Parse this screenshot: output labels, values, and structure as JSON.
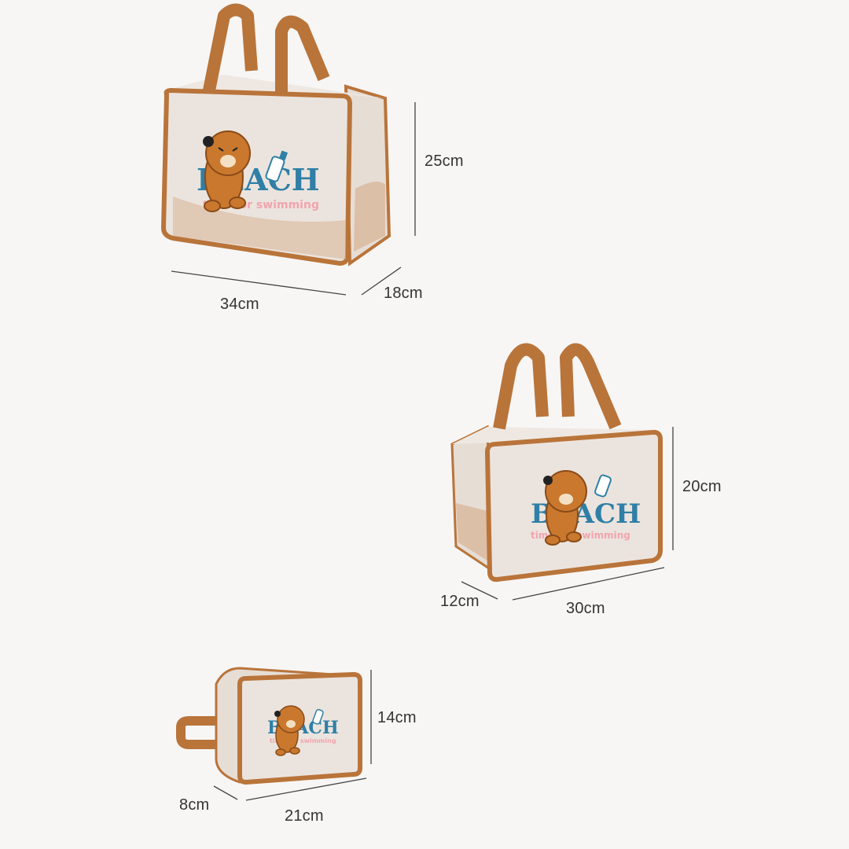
{
  "bags": [
    {
      "id": "large",
      "height": "25cm",
      "width": "34cm",
      "depth": "18cm",
      "print_word": "BEACH",
      "print_sub": "time for swimming"
    },
    {
      "id": "medium",
      "height": "20cm",
      "width": "30cm",
      "depth": "12cm",
      "print_word": "BEACH",
      "print_sub": "time for swimming"
    },
    {
      "id": "small",
      "height": "14cm",
      "width": "21cm",
      "depth": "8cm",
      "print_word": "BEACH",
      "print_sub": "time for swimming"
    }
  ],
  "colors": {
    "trim": "#b9743a",
    "trim_dark": "#8e5424",
    "body": "#ece6e1",
    "body_shade": "#d9c3b0",
    "text_blue": "#2f7fa6",
    "text_pink": "#f2a4ad",
    "bear": "#c9782e",
    "bear_dark": "#8a4a17"
  }
}
